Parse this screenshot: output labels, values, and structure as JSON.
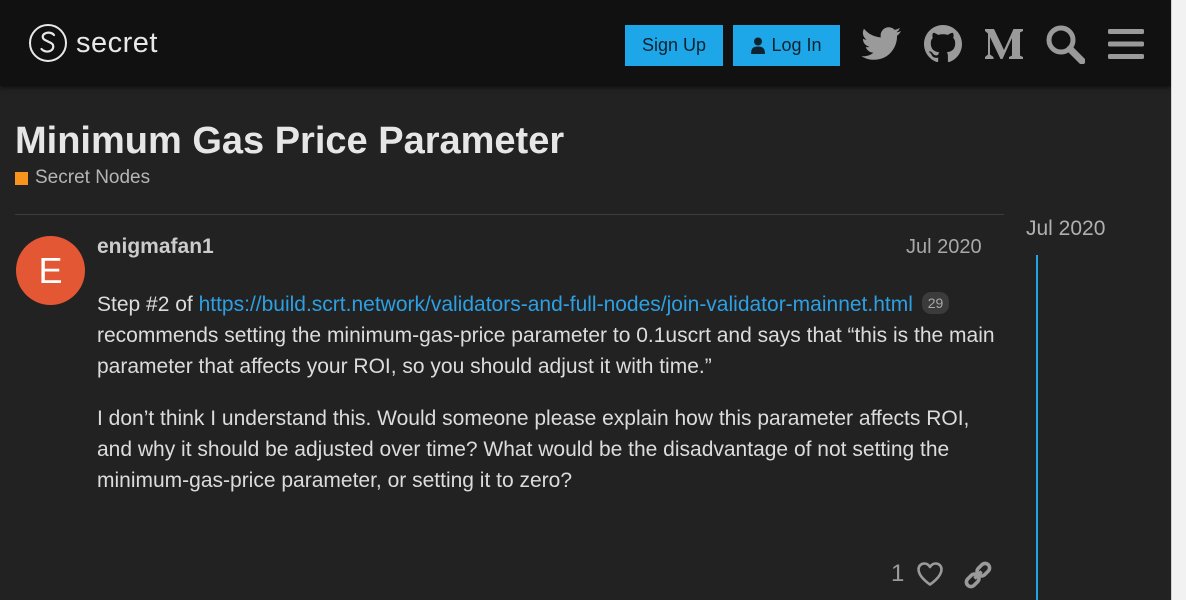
{
  "header": {
    "logo_text": "secret",
    "signup_label": "Sign Up",
    "login_label": "Log In",
    "icons": [
      "twitter-icon",
      "github-icon",
      "medium-icon",
      "search-icon",
      "hamburger-menu-icon"
    ]
  },
  "topic": {
    "title": "Minimum Gas Price Parameter",
    "category": "Secret Nodes",
    "category_color": "#f7941d"
  },
  "post": {
    "avatar_letter": "E",
    "avatar_color": "#e45735",
    "username": "enigmafan1",
    "date": "Jul 2020",
    "p1_prefix": "Step #2 of ",
    "link_text": "https://build.scrt.network/validators-and-full-nodes/join-validator-mainnet.html",
    "link_clicks": "29",
    "p1_suffix": "recommends setting the minimum-gas-price parameter to 0.1uscrt and says that “this is the main parameter that affects your ROI, so you should adjust it with time.”",
    "p2": "I don’t think I understand this. Would someone please explain how this parameter affects ROI, and why it should be adjusted over time? What would be the disadvantage of not setting the minimum-gas-price parameter, or setting it to zero?",
    "like_count": "1"
  },
  "timeline": {
    "date": "Jul 2020"
  },
  "colors": {
    "accent": "#1ea7e8",
    "link": "#2d9fe3",
    "background": "#222222",
    "header_bg": "#111111"
  }
}
